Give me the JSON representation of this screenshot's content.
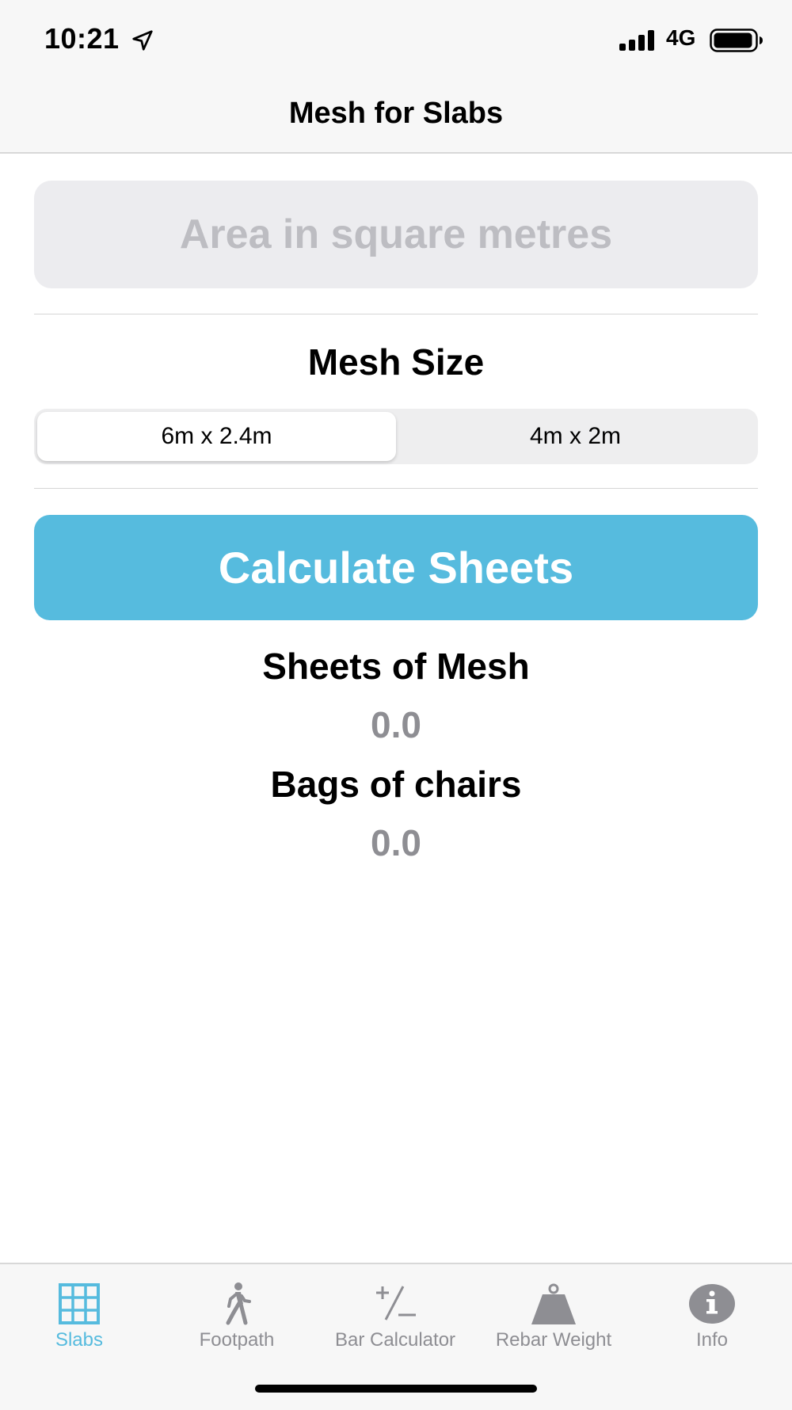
{
  "status_bar": {
    "time": "10:21",
    "network": "4G"
  },
  "nav": {
    "title": "Mesh for Slabs"
  },
  "area_input": {
    "placeholder": "Area in square metres",
    "value": ""
  },
  "mesh_size": {
    "title": "Mesh Size",
    "options": [
      "6m x 2.4m",
      "4m x 2m"
    ],
    "selected": "6m x 2.4m"
  },
  "calculate_button": {
    "label": "Calculate Sheets"
  },
  "results": {
    "sheets_label": "Sheets of Mesh",
    "sheets_value": "0.0",
    "chairs_label": "Bags of chairs",
    "chairs_value": "0.0"
  },
  "tabs": [
    {
      "label": "Slabs",
      "icon": "grid-icon",
      "active": true
    },
    {
      "label": "Footpath",
      "icon": "walking-person-icon",
      "active": false
    },
    {
      "label": "Bar Calculator",
      "icon": "plus-minus-icon",
      "active": false
    },
    {
      "label": "Rebar Weight",
      "icon": "weight-icon",
      "active": false
    },
    {
      "label": "Info",
      "icon": "info-icon",
      "active": false
    }
  ],
  "colors": {
    "accent": "#56bbde",
    "inactive": "#8e8e93",
    "input_bg": "#ececef",
    "placeholder": "#bdbdc2"
  }
}
